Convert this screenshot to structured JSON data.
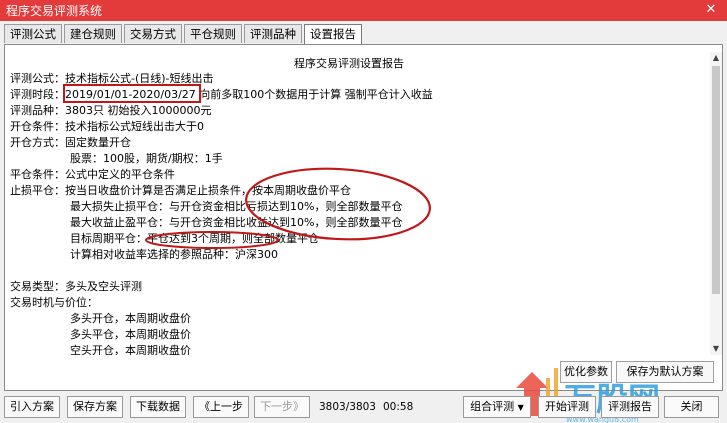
{
  "window": {
    "title": "程序交易评测系统",
    "close_icon": "✕"
  },
  "tabs": [
    "评测公式",
    "建仓规则",
    "交易方式",
    "平仓规则",
    "评测品种",
    "设置报告"
  ],
  "report": {
    "heading": "程序交易评测设置报告",
    "lines": [
      "评测公式：技术指标公式-(日线)-短线出击",
      "评测时段：2019/01/01-2020/03/27 向前多取100个数据用于计算 强制平仓计入收益",
      "评测品种：3803只  初始投入1000000元",
      "开仓条件：技术指标公式短线出击大于0",
      "开仓方式：固定数量开仓",
      "股票：100股，期货/期权：1手",
      "平仓条件：公式中定义的平仓条件",
      "止损平仓：按当日收盘价计算是否满足止损条件，按本周期收盘价平仓",
      "最大损失止损平仓：与开仓资金相比亏损达到10%，则全部数量平仓",
      "最大收益止盈平仓：与开仓资金相比收益达到10%，则全部数量平仓",
      "目标周期平仓：平仓达到3个周期，则全部数量平仓",
      "计算相对收益率选择的参照品种：沪深300",
      "",
      "交易类型：多头及空头评测",
      "交易时机与价位：",
      "多头开仓，本周期收盘价",
      "多头平仓，本周期收盘价",
      "空头开仓，本周期收盘价"
    ]
  },
  "side_buttons": {
    "optimize": "优化参数",
    "save_default": "保存为默认方案"
  },
  "bottom": {
    "import": "引入方案",
    "save": "保存方案",
    "download": "下载数据",
    "prev": "《上一步",
    "next": "下一步》",
    "progress": "3803/3803",
    "time": "00:58",
    "combo": "组合评测",
    "start": "开始评测",
    "report": "评测报告",
    "close": "关闭"
  },
  "watermark": {
    "text": "万股网",
    "subtext": "www.wangu8.com"
  },
  "colors": {
    "titlebar": "#e33b3b",
    "annotation": "#c01818",
    "watermark": "#2e9fe0"
  }
}
